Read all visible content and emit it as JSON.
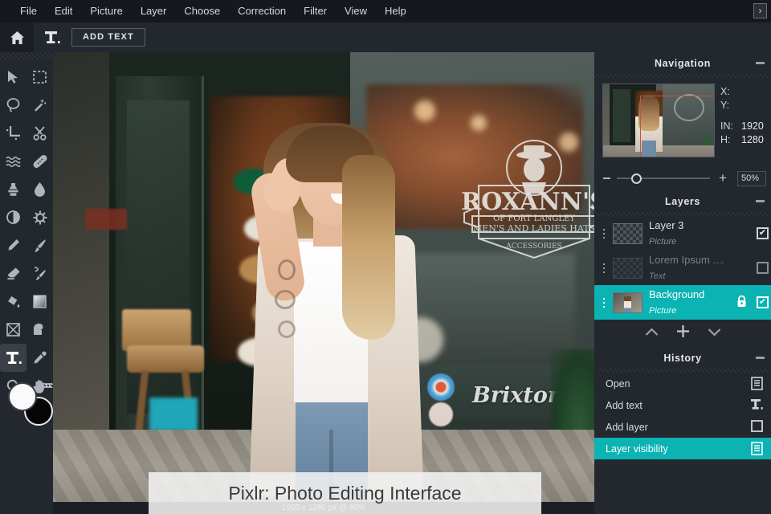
{
  "menubar": {
    "items": [
      "File",
      "Edit",
      "Picture",
      "Layer",
      "Choose",
      "Correction",
      "Filter",
      "View",
      "Help"
    ],
    "expand_label": "›"
  },
  "optionsbar": {
    "home_icon": "home-icon",
    "tool_icon": "text-tool-icon",
    "add_text_label": "ADD TEXT"
  },
  "toolbar": {
    "tools": [
      {
        "name": "move-tool",
        "icon": "arrow-cursor-icon",
        "active": false
      },
      {
        "name": "marquee-select-tool",
        "icon": "dashed-rectangle-icon",
        "active": false
      },
      {
        "name": "lasso-tool",
        "icon": "lasso-icon",
        "active": false
      },
      {
        "name": "magic-wand-tool",
        "icon": "magic-wand-icon",
        "active": false
      },
      {
        "name": "crop-tool",
        "icon": "crop-icon",
        "active": false
      },
      {
        "name": "cutout-tool",
        "icon": "scissors-icon",
        "active": false
      },
      {
        "name": "liquify-tool",
        "icon": "waves-icon",
        "active": false
      },
      {
        "name": "heal-tool",
        "icon": "bandage-icon",
        "active": false
      },
      {
        "name": "clone-stamp-tool",
        "icon": "stamp-icon",
        "active": false
      },
      {
        "name": "blur-tool",
        "icon": "water-drop-icon",
        "active": false
      },
      {
        "name": "dodge-burn-tool",
        "icon": "half-circle-icon",
        "active": false
      },
      {
        "name": "sharpen-tool",
        "icon": "sun-gear-icon",
        "active": false
      },
      {
        "name": "pencil-tool",
        "icon": "pencil-icon",
        "active": false
      },
      {
        "name": "brush-tool",
        "icon": "paintbrush-icon",
        "active": false
      },
      {
        "name": "eraser-tool",
        "icon": "eraser-icon",
        "active": false
      },
      {
        "name": "smudge-tool",
        "icon": "smudge-brush-icon",
        "active": false
      },
      {
        "name": "paint-bucket-tool",
        "icon": "paint-bucket-icon",
        "active": false
      },
      {
        "name": "gradient-tool",
        "icon": "gradient-square-icon",
        "active": false
      },
      {
        "name": "shape-tool",
        "icon": "crossed-box-icon",
        "active": false
      },
      {
        "name": "fill-shape-tool",
        "icon": "rounded-shape-icon",
        "active": false
      },
      {
        "name": "text-tool",
        "icon": "text-tool-icon",
        "active": true
      },
      {
        "name": "color-picker-tool",
        "icon": "eyedropper-icon",
        "active": false
      },
      {
        "name": "zoom-tool",
        "icon": "magnifier-icon",
        "active": false
      },
      {
        "name": "hand-tool",
        "icon": "hand-icon",
        "active": false
      }
    ],
    "foreground_color": "#fafafa",
    "background_color": "#060606",
    "swap_icon": "swap-colors-icon"
  },
  "canvas": {
    "status_text": "1920 x 1280 px @ 50%",
    "caption": "Pixlr: Photo Editing Interface",
    "scene": {
      "shop_sign_line1": "ROXANN'S",
      "shop_sign_line2": "OF FORT LANGLEY",
      "shop_sign_line3": "MEN'S AND LADIES HATS",
      "shop_sign_line4": "ACCESSORIES",
      "brand_decal": "Brixton"
    }
  },
  "navigation": {
    "title": "Navigation",
    "minimize_icon": "minimize-icon",
    "labels": {
      "x": "X:",
      "y": "Y:",
      "in": "IN:",
      "h": "H:"
    },
    "values": {
      "x": "",
      "y": "",
      "in": "1920",
      "h": "1280"
    },
    "zoom": {
      "minus_icon": "minus-icon",
      "plus_label": "+",
      "value": "50%",
      "handle_percent": 30
    }
  },
  "layers": {
    "title": "Layers",
    "minimize_icon": "minimize-icon",
    "items": [
      {
        "name": "Layer 3",
        "type": "Picture",
        "visible": true,
        "locked": false,
        "selected": false,
        "thumb": "checker"
      },
      {
        "name": "Lorem Ipsum ....",
        "type": "Text",
        "visible": false,
        "locked": false,
        "selected": false,
        "thumb": "checker"
      },
      {
        "name": "Background",
        "type": "Picture",
        "visible": true,
        "locked": true,
        "selected": true,
        "thumb": "photo"
      }
    ],
    "actions": [
      {
        "name": "move-layer-up-button",
        "icon": "chevron-up-icon"
      },
      {
        "name": "add-layer-button",
        "icon": "plus-icon"
      },
      {
        "name": "move-layer-down-button",
        "icon": "chevron-down-icon"
      }
    ],
    "check_glyph": "✔"
  },
  "history": {
    "title": "History",
    "minimize_icon": "minimize-icon",
    "items": [
      {
        "label": "Open",
        "icon": "document-icon",
        "selected": false
      },
      {
        "label": "Add text",
        "icon": "text-tool-icon",
        "selected": false
      },
      {
        "label": "Add layer",
        "icon": "square-icon",
        "selected": false
      },
      {
        "label": "Layer visibility",
        "icon": "document-icon",
        "selected": true
      }
    ]
  },
  "colors": {
    "accent": "#0bb3b3",
    "panel_bg": "#23272e",
    "menubar_bg": "#15181d",
    "text": "#d7dce0",
    "viewbox_outline": "#c4563a"
  }
}
